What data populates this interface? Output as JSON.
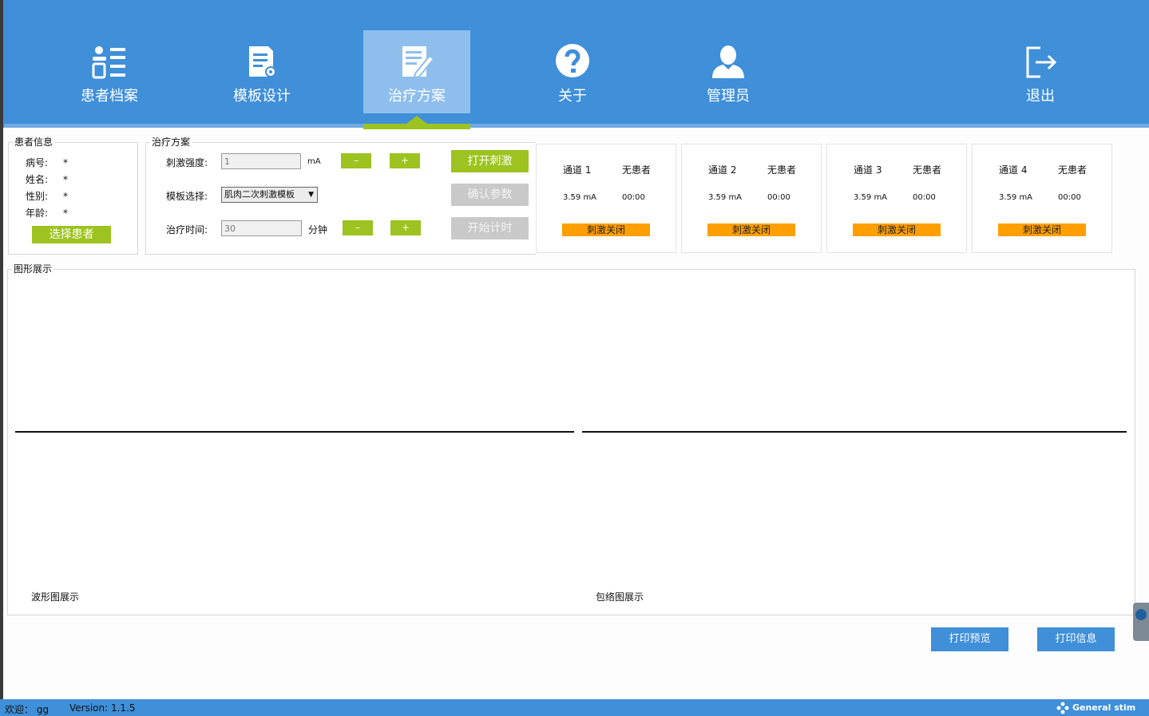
{
  "nav": {
    "items": [
      {
        "label": "患者档案",
        "icon": "patient-records-icon"
      },
      {
        "label": "模板设计",
        "icon": "template-design-icon"
      },
      {
        "label": "治疗方案",
        "icon": "treatment-plan-icon"
      },
      {
        "label": "关于",
        "icon": "help-icon"
      },
      {
        "label": "管理员",
        "icon": "admin-user-icon"
      },
      {
        "label": "退出",
        "icon": "exit-icon"
      }
    ],
    "active": "治疗方案"
  },
  "patient": {
    "title": "患者信息",
    "fields": [
      {
        "label": "病号:",
        "value": "*"
      },
      {
        "label": "姓名:",
        "value": "*"
      },
      {
        "label": "性别:",
        "value": "*"
      },
      {
        "label": "年龄:",
        "value": "*"
      }
    ],
    "select_button": "选择患者"
  },
  "plan": {
    "title": "治疗方案",
    "intensity_label": "刺激强度:",
    "intensity_value": "1",
    "intensity_unit": "mA",
    "template_label": "模板选择:",
    "template_value": "肌肉二次刺激模板",
    "time_label": "治疗时间:",
    "time_value": "30",
    "time_unit": "分钟",
    "minus": "–",
    "plus": "+",
    "open_button": "打开刺激",
    "confirm_button": "确认参数",
    "start_button": "开始计时"
  },
  "channels": [
    {
      "name": "通道 1",
      "patient": "无患者",
      "current": "3.59 mA",
      "time": "00:00",
      "status": "刺激关闭"
    },
    {
      "name": "通道 2",
      "patient": "无患者",
      "current": "3.59 mA",
      "time": "00:00",
      "status": "刺激关闭"
    },
    {
      "name": "通道 3",
      "patient": "无患者",
      "current": "3.59 mA",
      "time": "00:00",
      "status": "刺激关闭"
    },
    {
      "name": "通道 4",
      "patient": "无患者",
      "current": "3.59 mA",
      "time": "00:00",
      "status": "刺激关闭"
    }
  ],
  "graph": {
    "title": "图形展示",
    "waveform_label": "波形图展示",
    "envelope_label": "包络图展示"
  },
  "actions": {
    "print_preview": "打印预览",
    "print_info": "打印信息"
  },
  "status": {
    "welcome": "欢迎： gg",
    "version": "Version: 1.1.5",
    "brand": "General stim"
  }
}
